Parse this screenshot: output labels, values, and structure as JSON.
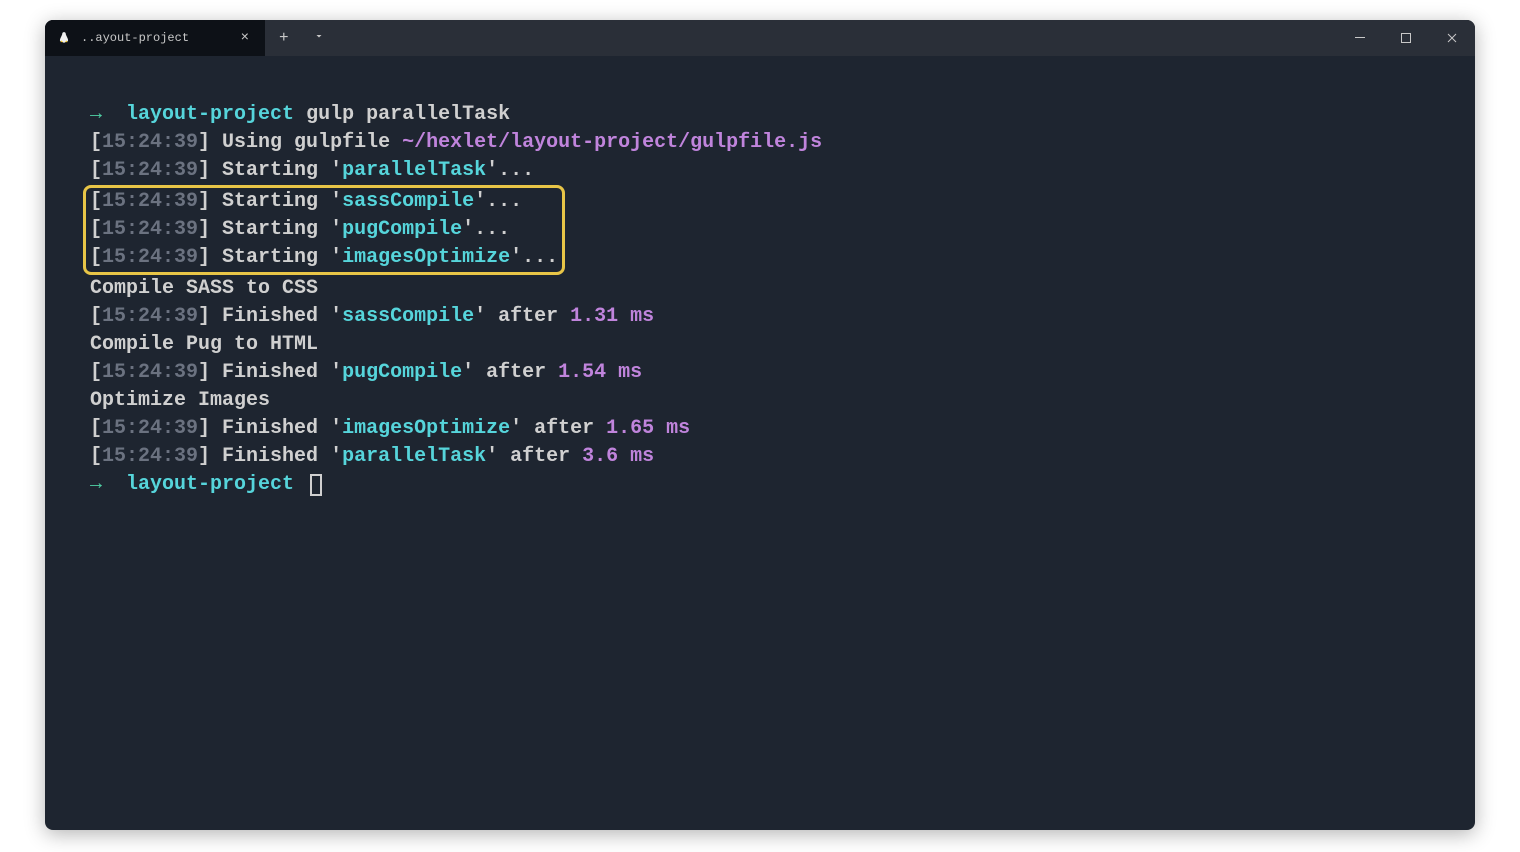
{
  "tab": {
    "title": "..ayout-project"
  },
  "prompt1": {
    "arrow": "→",
    "dir": "layout-project",
    "command": "gulp parallelTask"
  },
  "lines": {
    "l1_ts": "15:24:39",
    "l1_text": "Using gulpfile ",
    "l1_path": "~/hexlet/layout-project/gulpfile.js",
    "l2_ts": "15:24:39",
    "l2_starting": "Starting '",
    "l2_task": "parallelTask",
    "l2_after": "'...",
    "l3_ts": "15:24:39",
    "l3_task": "sassCompile",
    "l4_ts": "15:24:39",
    "l4_task": "pugCompile",
    "l5_ts": "15:24:39",
    "l5_task": "imagesOptimize",
    "l6_text": "Compile SASS to CSS",
    "l7_ts": "15:24:39",
    "l7_finished": "Finished '",
    "l7_task": "sassCompile",
    "l7_after": "' after ",
    "l7_time": "1.31 ms",
    "l8_text": "Compile Pug to HTML",
    "l9_ts": "15:24:39",
    "l9_task": "pugCompile",
    "l9_time": "1.54 ms",
    "l10_text": "Optimize Images",
    "l11_ts": "15:24:39",
    "l11_task": "imagesOptimize",
    "l11_time": "1.65 ms",
    "l12_ts": "15:24:39",
    "l12_task": "parallelTask",
    "l12_time": "3.6 ms"
  },
  "prompt2": {
    "arrow": "→",
    "dir": "layout-project"
  }
}
